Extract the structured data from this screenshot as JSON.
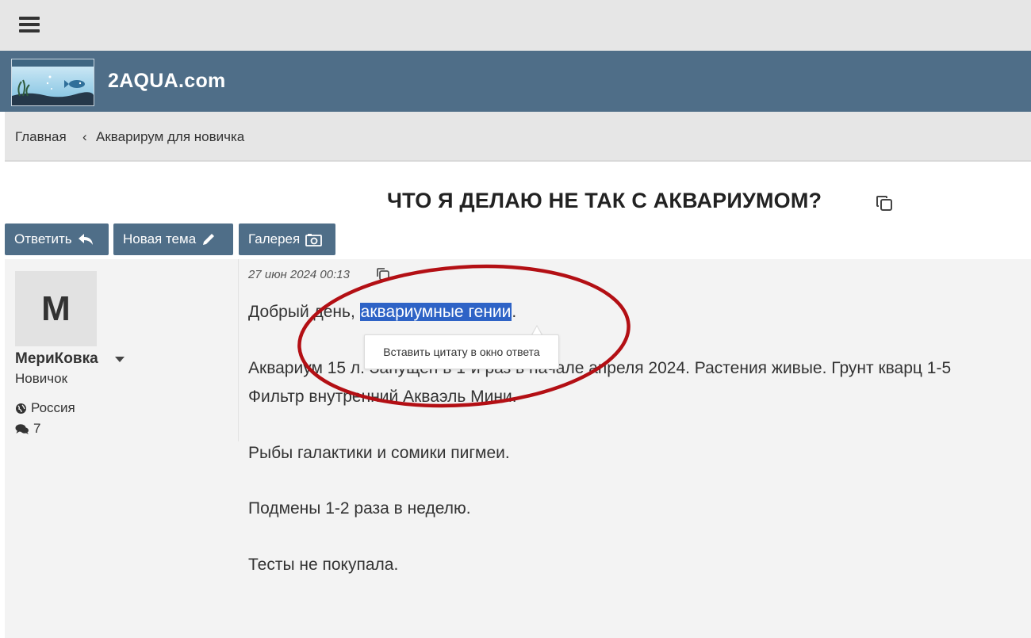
{
  "site": {
    "name": "2AQUA.com"
  },
  "breadcrumb": {
    "home": "Главная",
    "separator": "‹",
    "section": "Акварирум для новичка"
  },
  "topic": {
    "title": "ЧТО Я ДЕЛАЮ НЕ ТАК С АКВАРИУМОМ?"
  },
  "buttons": {
    "reply": "Ответить",
    "new_topic": "Новая тема",
    "gallery": "Галерея"
  },
  "author": {
    "avatar_letter": "М",
    "name": "МериКовка",
    "rank": "Новичок",
    "location": "Россия",
    "posts": "7"
  },
  "post": {
    "date": "27 июн 2024 00:13",
    "greeting_prefix": "Добрый день, ",
    "greeting_selected": "аквариумные гении",
    "greeting_suffix": ".",
    "line_aquarium": "Аквариум 15 л. Запущен в 1-й раз в начале апреля 2024. Растения живые. Грунт кварц 1-5",
    "line_filter": "Фильтр внутренний Акваэль Мини.",
    "line_fish": "Рыбы галактики и сомики пигмеи.",
    "line_changes": "Подмены 1-2 раза в неделю.",
    "line_tests": "Тесты не покупала."
  },
  "tooltip": {
    "label": "Вставить цитату в окно ответа"
  },
  "colors": {
    "header": "#4f6e88",
    "topbar": "#e6e6e6",
    "selection": "#2e63c6",
    "annotation": "#b30f14"
  }
}
